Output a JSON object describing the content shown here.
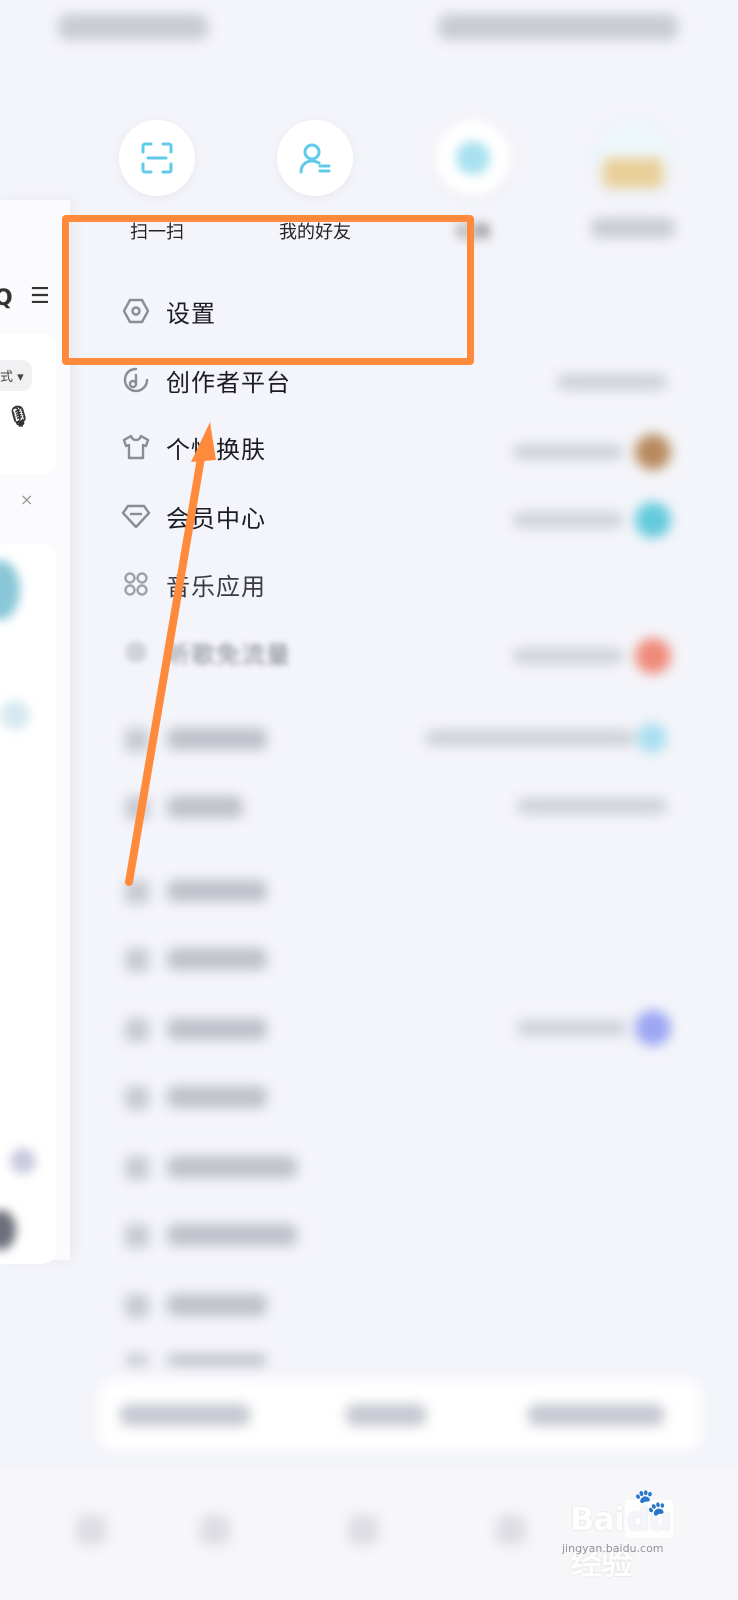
{
  "quick_actions": [
    {
      "label": "扫一扫",
      "icon": "scan-icon"
    },
    {
      "label": "我的好友",
      "icon": "friends-icon"
    },
    {
      "label": "切换",
      "icon": "switch-icon"
    },
    {
      "label": "",
      "icon": "theme-icon"
    }
  ],
  "menu": [
    {
      "label": "设置",
      "icon": "settings-hexagon-icon"
    },
    {
      "label": "创作者平台",
      "icon": "creator-icon"
    },
    {
      "label": "个性换肤",
      "icon": "tshirt-icon"
    },
    {
      "label": "会员中心",
      "icon": "diamond-icon"
    },
    {
      "label": "音乐应用",
      "icon": "apps-grid-icon"
    },
    {
      "label": "听歌免流量",
      "icon": "data-free-icon"
    }
  ],
  "left_panel": {
    "mode_label": "式",
    "close_glyph": "×"
  },
  "annotation": {
    "highlight_color": "#ff8a3c",
    "arrow_color": "#ff8a3c"
  },
  "colors": {
    "background": "#f4f5fa",
    "quick_icon": "#5fcbe8",
    "menu_icon": "#8a8c96"
  },
  "watermark": {
    "logo": "Bai du 经验",
    "url": "jingyan.baidu.com"
  }
}
